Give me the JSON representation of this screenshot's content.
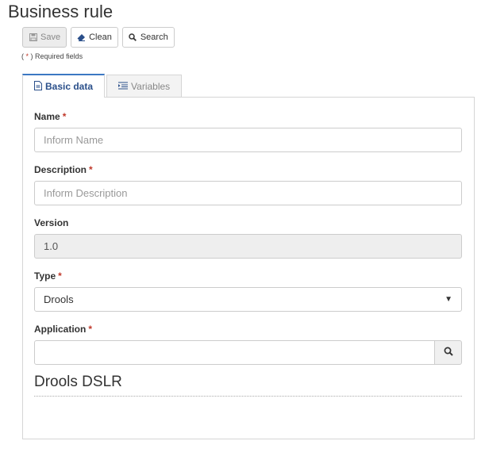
{
  "page": {
    "title": "Business rule"
  },
  "toolbar": {
    "save_label": "Save",
    "clean_label": "Clean",
    "search_label": "Search"
  },
  "required_note": {
    "prefix": "(",
    "star": "*",
    "suffix": ") Required fields"
  },
  "tabs": [
    {
      "label": "Basic data",
      "active": true,
      "icon": "document-icon"
    },
    {
      "label": "Variables",
      "active": false,
      "icon": "list-indent-icon"
    }
  ],
  "form": {
    "name": {
      "label": "Name",
      "required_mark": "*",
      "placeholder": "Inform Name",
      "value": ""
    },
    "description": {
      "label": "Description",
      "required_mark": "*",
      "placeholder": "Inform Description",
      "value": ""
    },
    "version": {
      "label": "Version",
      "value": "1.0"
    },
    "type": {
      "label": "Type",
      "required_mark": "*",
      "selected": "Drools"
    },
    "application": {
      "label": "Application",
      "required_mark": "*",
      "value": ""
    }
  },
  "section": {
    "title": "Drools DSLR"
  },
  "colors": {
    "accent": "#3c78c3",
    "required": "#c0392b",
    "border": "#cccccc"
  }
}
